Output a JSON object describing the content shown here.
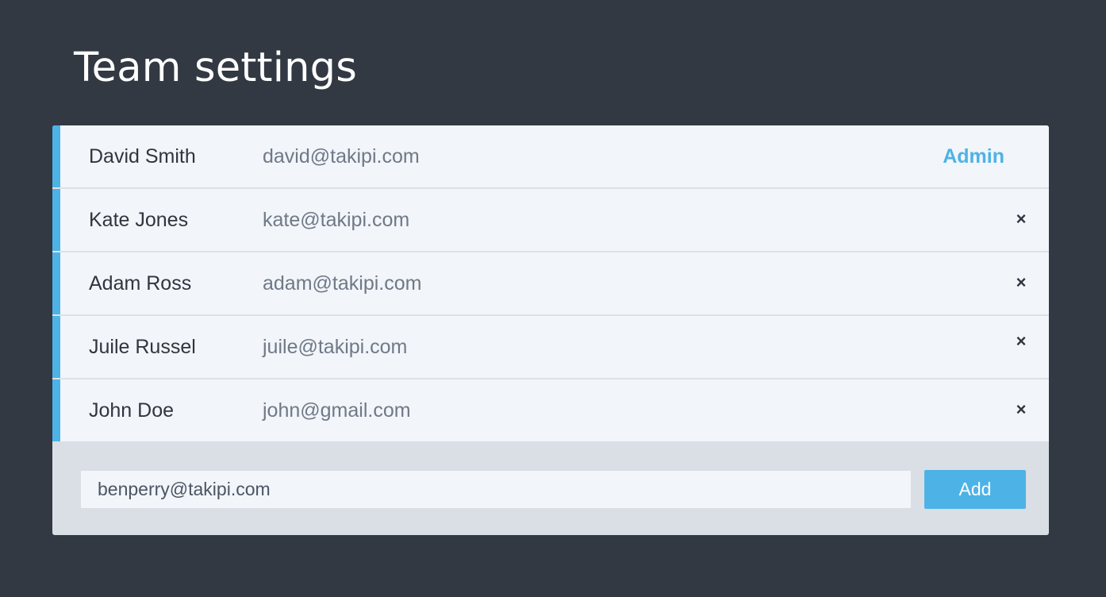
{
  "page": {
    "title": "Team settings"
  },
  "members": [
    {
      "name": "David Smith",
      "email": "david@takipi.com",
      "role": "Admin"
    },
    {
      "name": "Kate Jones",
      "email": "kate@takipi.com",
      "action": "×"
    },
    {
      "name": "Adam Ross",
      "email": "adam@takipi.com",
      "action": "×"
    },
    {
      "name": "Juile Russel",
      "email": "juile@takipi.com",
      "action": "×"
    },
    {
      "name": "John Doe",
      "email": "john@gmail.com",
      "action": "×"
    }
  ],
  "add_form": {
    "email_value": "benperry@takipi.com",
    "add_label": "Add"
  },
  "icons": {
    "remove": "close-icon"
  },
  "colors": {
    "background": "#323943",
    "accent": "#4db3e6",
    "row_background": "#f2f5f9",
    "footer_background": "#dadee5"
  }
}
